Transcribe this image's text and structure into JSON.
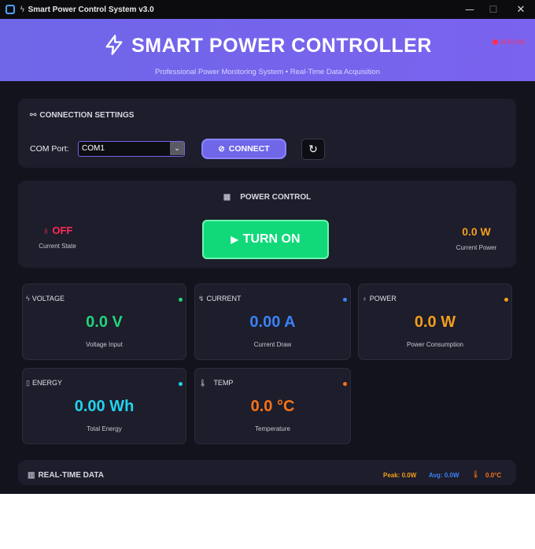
{
  "window": {
    "title": "Smart Power Control System v3.0"
  },
  "header": {
    "title": "SMART POWER CONTROLLER",
    "subtitle": "Professional Power Monitoring System • Real-Time Data Acquisition",
    "status": "OFFLINE"
  },
  "connection": {
    "title": "CONNECTION SETTINGS",
    "com_label": "COM Port:",
    "com_value": "COM1",
    "connect_label": "CONNECT",
    "refresh_glyph": "↻"
  },
  "power_control": {
    "title": "POWER CONTROL",
    "state_value": "OFF",
    "state_label": "Current State",
    "button_label": "TURN ON",
    "power_value": "0.0 W",
    "power_label": "Current Power"
  },
  "metrics": [
    {
      "label": "VOLTAGE",
      "value": "0.0 V",
      "sub": "Voltage Input",
      "color": "#21d47a"
    },
    {
      "label": "CURRENT",
      "value": "0.00 A",
      "sub": "Current Draw",
      "color": "#3b82f6"
    },
    {
      "label": "POWER",
      "value": "0.0 W",
      "sub": "Power Consumption",
      "color": "#f59e1b"
    },
    {
      "label": "ENERGY",
      "value": "0.00 Wh",
      "sub": "Total Energy",
      "color": "#22d3ee"
    },
    {
      "label": "TEMP",
      "value": "0.0 °C",
      "sub": "Temperature",
      "color": "#f97316"
    }
  ],
  "realtime": {
    "title": "REAL-TIME DATA",
    "peak": "Peak: 0.0W",
    "avg": "Avg: 0.0W",
    "temp": "0.0°C"
  }
}
